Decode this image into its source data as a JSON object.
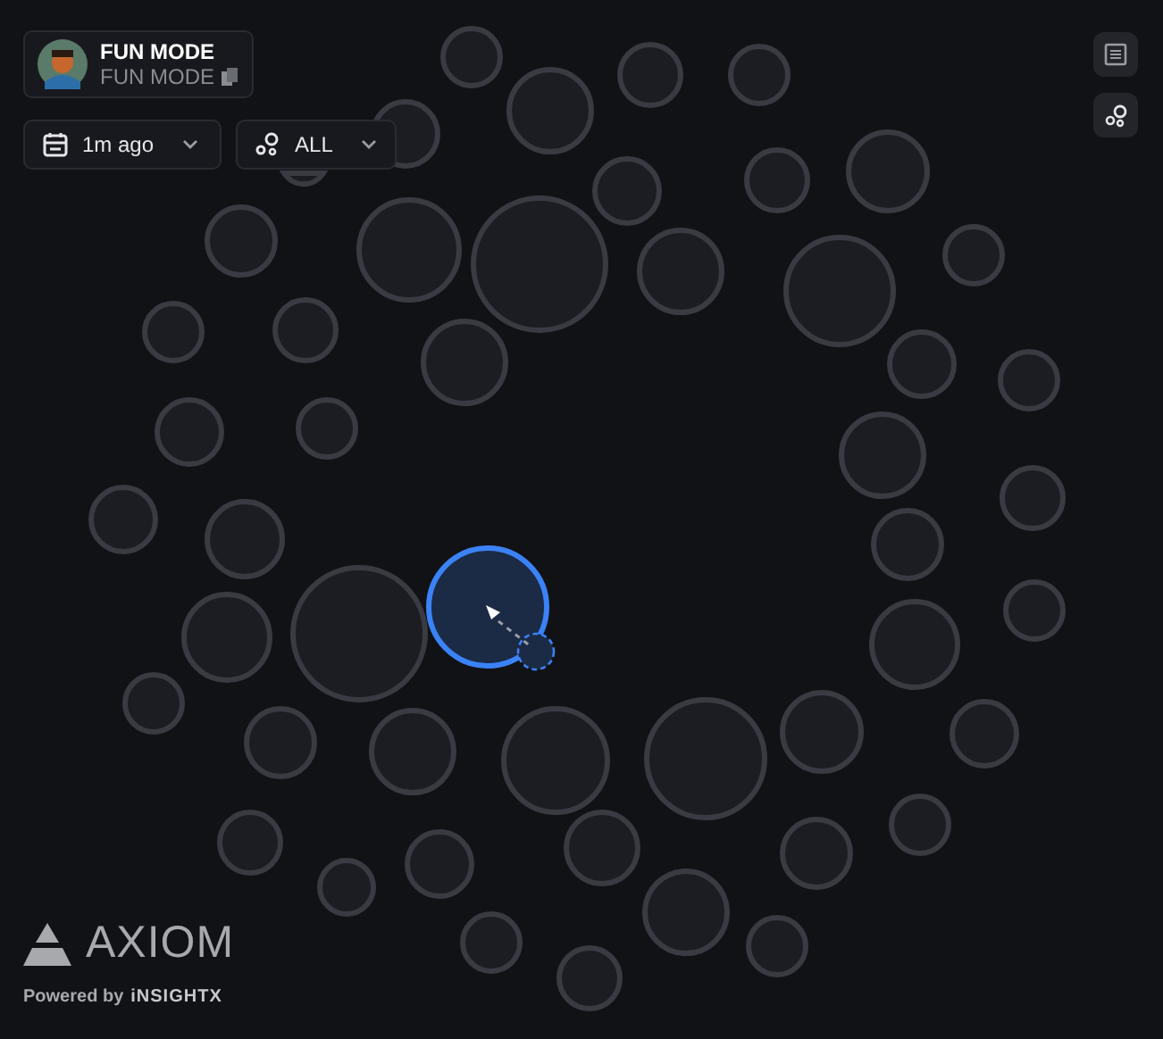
{
  "profile": {
    "name": "FUN MODE",
    "subtitle": "FUN MODE"
  },
  "filters": [
    {
      "kind": "time",
      "label": "1m ago"
    },
    {
      "kind": "group",
      "label": "ALL"
    }
  ],
  "toolbar": [
    {
      "kind": "list"
    },
    {
      "kind": "bubbles"
    }
  ],
  "bubbles": [
    {
      "selected": false
    },
    {
      "selected": false
    },
    {
      "selected": false
    },
    {
      "selected": false
    },
    {
      "selected": false
    },
    {
      "selected": false
    },
    {
      "selected": false
    },
    {
      "selected": false
    },
    {
      "selected": false
    },
    {
      "selected": false
    },
    {
      "selected": false
    },
    {
      "selected": false
    },
    {
      "selected": false
    },
    {
      "selected": false
    },
    {
      "selected": false
    },
    {
      "selected": false
    },
    {
      "selected": false
    },
    {
      "selected": false
    },
    {
      "selected": false
    },
    {
      "selected": false
    },
    {
      "selected": false
    },
    {
      "selected": false
    },
    {
      "selected": false
    },
    {
      "selected": false
    },
    {
      "selected": false
    },
    {
      "selected": false
    },
    {
      "selected": false
    },
    {
      "selected": false
    },
    {
      "selected": true
    },
    {
      "selected": false
    },
    {
      "selected": false
    },
    {
      "selected": false
    },
    {
      "selected": false
    },
    {
      "selected": false
    },
    {
      "selected": false
    },
    {
      "selected": false
    },
    {
      "selected": false
    },
    {
      "selected": false
    },
    {
      "selected": false
    },
    {
      "selected": false
    },
    {
      "selected": false
    },
    {
      "selected": false
    },
    {
      "selected": false
    },
    {
      "selected": false
    },
    {
      "selected": false
    },
    {
      "selected": false
    },
    {
      "selected": false
    },
    {
      "selected": false
    },
    {
      "selected": false
    }
  ],
  "brand": {
    "name": "AXIOM",
    "powered_by": "Powered by",
    "vendor": "iNSIGHTX"
  }
}
